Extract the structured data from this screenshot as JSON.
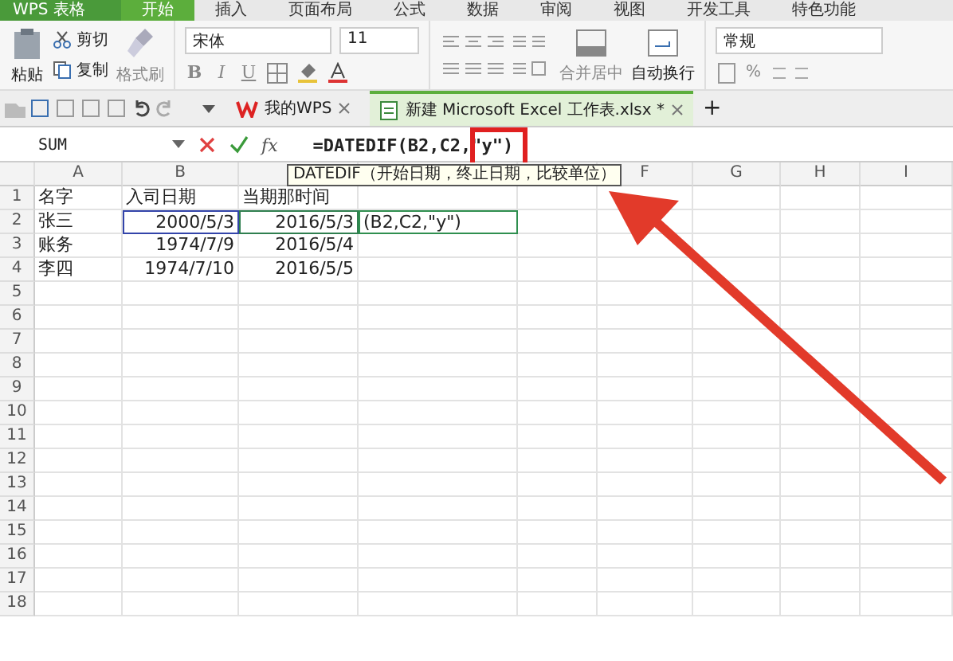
{
  "app_button": "WPS 表格",
  "ribbon_tabs": [
    {
      "label": "开始",
      "selected": true
    },
    {
      "label": "插入",
      "selected": false
    },
    {
      "label": "页面布局",
      "selected": false
    },
    {
      "label": "公式",
      "selected": false
    },
    {
      "label": "数据",
      "selected": false
    },
    {
      "label": "审阅",
      "selected": false
    },
    {
      "label": "视图",
      "selected": false
    },
    {
      "label": "开发工具",
      "selected": false
    },
    {
      "label": "特色功能",
      "selected": false
    }
  ],
  "clipboard": {
    "paste": "粘贴",
    "cut": "剪切",
    "copy": "复制",
    "format_painter": "格式刷"
  },
  "font": {
    "family": "宋体",
    "size": "11"
  },
  "style_buttons": [
    "B",
    "I",
    "U"
  ],
  "alignment": {
    "merge": "合并居中",
    "wrap": "自动换行"
  },
  "number": {
    "format": "常规",
    "percent": "%"
  },
  "doc_tabs": [
    {
      "label": "我的WPS",
      "selected": false
    },
    {
      "label": "新建 Microsoft Excel 工作表.xlsx *",
      "selected": true
    }
  ],
  "new_tab": "+",
  "formula_bar": {
    "name_box": "SUM",
    "fx": "fx",
    "formula": "=DATEDIF(B2,C2,\"y\")"
  },
  "tooltip": "DATEDIF（开始日期，终止日期，比较单位）",
  "column_headers": [
    "A",
    "B",
    "F",
    "G",
    "H",
    "I"
  ],
  "rows": [
    {
      "number": "1",
      "cells": [
        {
          "text": "名字",
          "kind": "plain"
        },
        {
          "text": "入司日期",
          "kind": "plain"
        },
        {
          "text": "当期那时间",
          "kind": "plain"
        }
      ]
    },
    {
      "number": "2",
      "cells": [
        {
          "text": "张三",
          "kind": "plain"
        },
        {
          "text": "2000/5/3",
          "kind": "reference",
          "color": "#3344aa"
        },
        {
          "text": "2016/5/3",
          "kind": "reference",
          "color": "#2f7f4f"
        },
        {
          "text": "(B2,C2,\"y\")",
          "kind": "editing"
        }
      ]
    },
    {
      "number": "3",
      "cells": [
        {
          "text": "账务",
          "kind": "plain"
        },
        {
          "text": "1974/7/9",
          "kind": "plain"
        },
        {
          "text": "2016/5/4",
          "kind": "plain"
        }
      ]
    },
    {
      "number": "4",
      "cells": [
        {
          "text": "李四",
          "kind": "plain"
        },
        {
          "text": "1974/7/10",
          "kind": "plain"
        },
        {
          "text": "2016/5/5",
          "kind": "plain"
        }
      ]
    },
    {
      "number": "5",
      "cells": []
    },
    {
      "number": "6",
      "cells": []
    },
    {
      "number": "7",
      "cells": []
    },
    {
      "number": "8",
      "cells": []
    },
    {
      "number": "9",
      "cells": []
    },
    {
      "number": "10",
      "cells": []
    },
    {
      "number": "11",
      "cells": []
    },
    {
      "number": "12",
      "cells": []
    },
    {
      "number": "13",
      "cells": []
    },
    {
      "number": "14",
      "cells": []
    },
    {
      "number": "15",
      "cells": []
    },
    {
      "number": "16",
      "cells": []
    },
    {
      "number": "17",
      "cells": []
    },
    {
      "number": "18",
      "cells": []
    }
  ]
}
